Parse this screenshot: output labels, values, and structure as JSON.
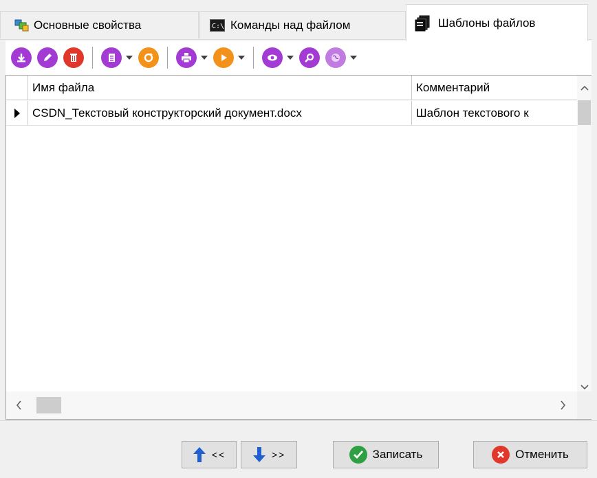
{
  "tabs": [
    {
      "label": "Основные свойства",
      "icon": "properties-icon",
      "active": false
    },
    {
      "label": "Команды над файлом",
      "icon": "console-icon",
      "active": false
    },
    {
      "label": "Шаблоны файлов",
      "icon": "templates-icon",
      "active": true
    }
  ],
  "toolbar": {
    "buttons": [
      "download-icon",
      "edit-icon",
      "delete-icon",
      "document-icon",
      "refresh-icon",
      "print-icon",
      "run-icon",
      "view-icon",
      "search-icon",
      "globe-icon"
    ],
    "colors": {
      "purple": "#a23ad3",
      "red": "#e0372a",
      "orange": "#f2921a"
    }
  },
  "grid": {
    "columns": [
      "Имя файла",
      "Комментарий"
    ],
    "rows": [
      {
        "file_name": "CSDN_Текстовый конструкторский документ.docx",
        "comment": "Шаблон текстового к"
      }
    ]
  },
  "buttons": {
    "prev": "<<",
    "next": ">>",
    "save": "Записать",
    "cancel": "Отменить"
  },
  "colors": {
    "save": "#2ea043",
    "cancel": "#e0372a",
    "arrow": "#1f5fd1"
  }
}
